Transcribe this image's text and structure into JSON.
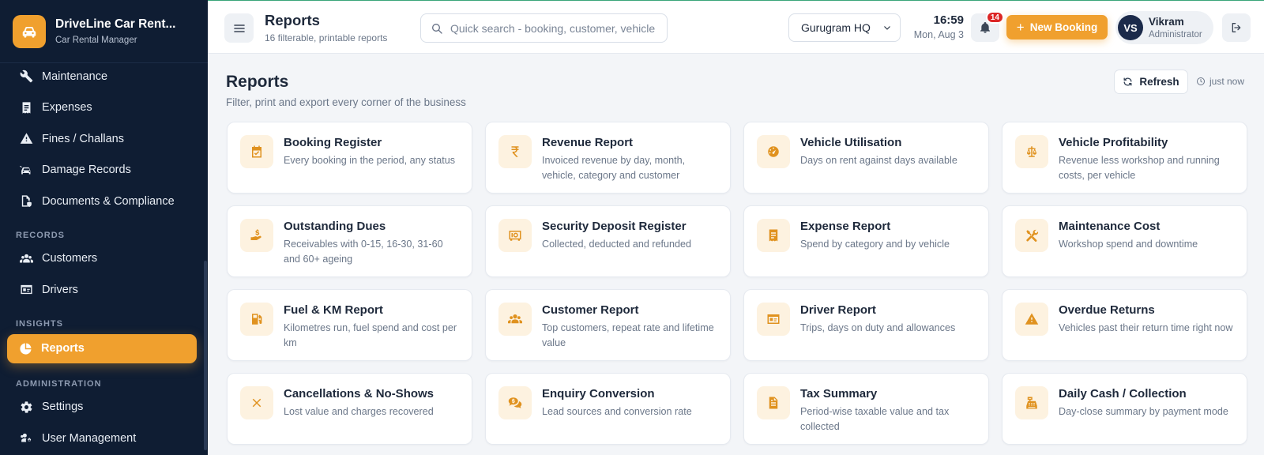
{
  "brand": {
    "title": "DriveLine Car Rent...",
    "subtitle": "Car Rental Manager"
  },
  "sidebar": {
    "items_top": [
      {
        "label": "Maintenance",
        "icon": "wrench-icon"
      },
      {
        "label": "Expenses",
        "icon": "receipt-icon"
      },
      {
        "label": "Fines / Challans",
        "icon": "warning-icon"
      },
      {
        "label": "Damage Records",
        "icon": "car-crash-icon"
      },
      {
        "label": "Documents & Compliance",
        "icon": "file-shield-icon"
      }
    ],
    "section_records": "RECORDS",
    "items_records": [
      {
        "label": "Customers",
        "icon": "users-icon"
      },
      {
        "label": "Drivers",
        "icon": "id-card-icon"
      }
    ],
    "section_insights": "INSIGHTS",
    "items_insights": [
      {
        "label": "Reports",
        "icon": "pie-chart-icon",
        "active": true
      }
    ],
    "section_admin": "ADMINISTRATION",
    "items_admin": [
      {
        "label": "Settings",
        "icon": "gear-icon"
      },
      {
        "label": "User Management",
        "icon": "users-cog-icon"
      }
    ]
  },
  "header": {
    "title": "Reports",
    "subtitle": "16 filterable, printable reports",
    "search_placeholder": "Quick search - booking, customer, vehicle",
    "branch": "Gurugram HQ",
    "time": "16:59",
    "date": "Mon, Aug 3",
    "notifications": "14",
    "new_booking": "New Booking",
    "user_initials": "VS",
    "user_name": "Vikram",
    "user_role": "Administrator"
  },
  "main": {
    "title": "Reports",
    "subtitle": "Filter, print and export every corner of the business",
    "refresh": "Refresh",
    "updated": "just now"
  },
  "reports": [
    {
      "title": "Booking Register",
      "desc": "Every booking in the period, any status",
      "icon": "calendar-check-icon"
    },
    {
      "title": "Revenue Report",
      "desc": "Invoiced revenue by day, month, vehicle, category and customer",
      "icon": "rupee-icon"
    },
    {
      "title": "Vehicle Utilisation",
      "desc": "Days on rent against days available",
      "icon": "gauge-icon"
    },
    {
      "title": "Vehicle Profitability",
      "desc": "Revenue less workshop and running costs, per vehicle",
      "icon": "scale-icon"
    },
    {
      "title": "Outstanding Dues",
      "desc": "Receivables with 0-15, 16-30, 31-60 and 60+ ageing",
      "icon": "hand-holding-dollar-icon"
    },
    {
      "title": "Security Deposit Register",
      "desc": "Collected, deducted and refunded",
      "icon": "vault-icon"
    },
    {
      "title": "Expense Report",
      "desc": "Spend by category and by vehicle",
      "icon": "receipt-icon"
    },
    {
      "title": "Maintenance Cost",
      "desc": "Workshop spend and downtime",
      "icon": "tools-icon"
    },
    {
      "title": "Fuel & KM Report",
      "desc": "Kilometres run, fuel spend and cost per km",
      "icon": "fuel-icon"
    },
    {
      "title": "Customer Report",
      "desc": "Top customers, repeat rate and lifetime value",
      "icon": "users-icon"
    },
    {
      "title": "Driver Report",
      "desc": "Trips, days on duty and allowances",
      "icon": "id-card-icon"
    },
    {
      "title": "Overdue Returns",
      "desc": "Vehicles past their return time right now",
      "icon": "warning-icon"
    },
    {
      "title": "Cancellations & No-Shows",
      "desc": "Lost value and charges recovered",
      "icon": "x-icon"
    },
    {
      "title": "Enquiry Conversion",
      "desc": "Lead sources and conversion rate",
      "icon": "comments-dollar-icon"
    },
    {
      "title": "Tax Summary",
      "desc": "Period-wise taxable value and tax collected",
      "icon": "file-invoice-icon"
    },
    {
      "title": "Daily Cash / Collection",
      "desc": "Day-close summary by payment mode",
      "icon": "cash-register-icon"
    }
  ],
  "colors": {
    "accent": "#f0a02e",
    "sidebar": "#0f1d33",
    "icon_bg": "#fdf2e0"
  }
}
